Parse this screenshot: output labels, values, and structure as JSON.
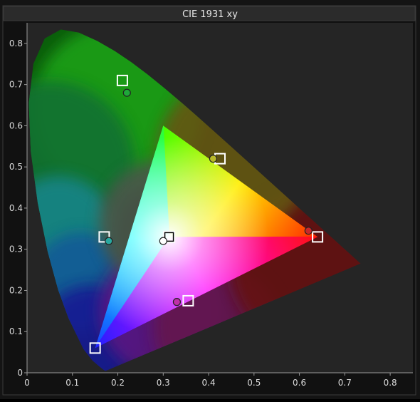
{
  "chart_data": {
    "type": "scatter",
    "title": "CIE 1931 xy",
    "xlabel": "",
    "ylabel": "",
    "xlim": [
      0,
      0.85
    ],
    "ylim": [
      0,
      0.85
    ],
    "x_ticks": [
      "0",
      "0.1",
      "0.2",
      "0.3",
      "0.4",
      "0.5",
      "0.6",
      "0.7",
      "0.8"
    ],
    "y_ticks": [
      "0",
      "0.1",
      "0.2",
      "0.3",
      "0.4",
      "0.5",
      "0.6",
      "0.7",
      "0.8"
    ],
    "grid": false,
    "background": "#252525",
    "spectral_locus": [
      [
        0.1741,
        0.005
      ],
      [
        0.1738,
        0.0049
      ],
      [
        0.1733,
        0.0048
      ],
      [
        0.1726,
        0.0048
      ],
      [
        0.1714,
        0.0051
      ],
      [
        0.1689,
        0.0069
      ],
      [
        0.1644,
        0.0109
      ],
      [
        0.1566,
        0.0177
      ],
      [
        0.144,
        0.0297
      ],
      [
        0.1241,
        0.0578
      ],
      [
        0.0913,
        0.1327
      ],
      [
        0.0687,
        0.2007
      ],
      [
        0.0454,
        0.295
      ],
      [
        0.0235,
        0.4127
      ],
      [
        0.0082,
        0.5384
      ],
      [
        0.0039,
        0.6548
      ],
      [
        0.0139,
        0.7502
      ],
      [
        0.0389,
        0.812
      ],
      [
        0.0743,
        0.8338
      ],
      [
        0.1142,
        0.8262
      ],
      [
        0.1547,
        0.8059
      ],
      [
        0.1929,
        0.7816
      ],
      [
        0.2296,
        0.7543
      ],
      [
        0.2658,
        0.7243
      ],
      [
        0.3016,
        0.6923
      ],
      [
        0.3373,
        0.6589
      ],
      [
        0.3731,
        0.6245
      ],
      [
        0.4087,
        0.5896
      ],
      [
        0.4441,
        0.5547
      ],
      [
        0.4788,
        0.5202
      ],
      [
        0.5125,
        0.4866
      ],
      [
        0.5448,
        0.4544
      ],
      [
        0.5752,
        0.4242
      ],
      [
        0.6029,
        0.3965
      ],
      [
        0.627,
        0.3725
      ],
      [
        0.6482,
        0.3514
      ],
      [
        0.6658,
        0.334
      ],
      [
        0.6801,
        0.3197
      ],
      [
        0.6915,
        0.3083
      ],
      [
        0.7006,
        0.2993
      ],
      [
        0.7079,
        0.292
      ],
      [
        0.714,
        0.2859
      ],
      [
        0.719,
        0.2809
      ],
      [
        0.723,
        0.277
      ],
      [
        0.726,
        0.274
      ],
      [
        0.7283,
        0.2717
      ],
      [
        0.73,
        0.27
      ],
      [
        0.7311,
        0.2689
      ],
      [
        0.732,
        0.268
      ],
      [
        0.7327,
        0.2673
      ],
      [
        0.7334,
        0.2666
      ],
      [
        0.734,
        0.266
      ],
      [
        0.7344,
        0.2656
      ],
      [
        0.7346,
        0.2654
      ],
      [
        0.7347,
        0.2653
      ]
    ],
    "gamut_triangle": [
      [
        0.64,
        0.33
      ],
      [
        0.3,
        0.6
      ],
      [
        0.15,
        0.06
      ]
    ],
    "series": [
      {
        "kind": "target",
        "marker": "square",
        "points": [
          {
            "color": "red",
            "x": 0.64,
            "y": 0.33
          },
          {
            "color": "green",
            "x": 0.21,
            "y": 0.71
          },
          {
            "color": "blue",
            "x": 0.15,
            "y": 0.06
          },
          {
            "color": "cyan",
            "x": 0.17,
            "y": 0.33
          },
          {
            "color": "magenta",
            "x": 0.355,
            "y": 0.175
          },
          {
            "color": "yellow",
            "x": 0.425,
            "y": 0.52
          },
          {
            "color": "white",
            "x": 0.313,
            "y": 0.33
          }
        ]
      },
      {
        "kind": "measured",
        "marker": "circle",
        "points": [
          {
            "color": "red",
            "x": 0.62,
            "y": 0.345,
            "fill": "#c8282a"
          },
          {
            "color": "green",
            "x": 0.22,
            "y": 0.68,
            "fill": "#1fa83a"
          },
          {
            "color": "cyan",
            "x": 0.18,
            "y": 0.32,
            "fill": "#28a8a0"
          },
          {
            "color": "magenta",
            "x": 0.33,
            "y": 0.172,
            "fill": "#c030a8"
          },
          {
            "color": "yellow",
            "x": 0.41,
            "y": 0.52,
            "fill": "#b8b828"
          },
          {
            "color": "white",
            "x": 0.3,
            "y": 0.32,
            "fill": "#ffffff"
          }
        ]
      }
    ]
  }
}
